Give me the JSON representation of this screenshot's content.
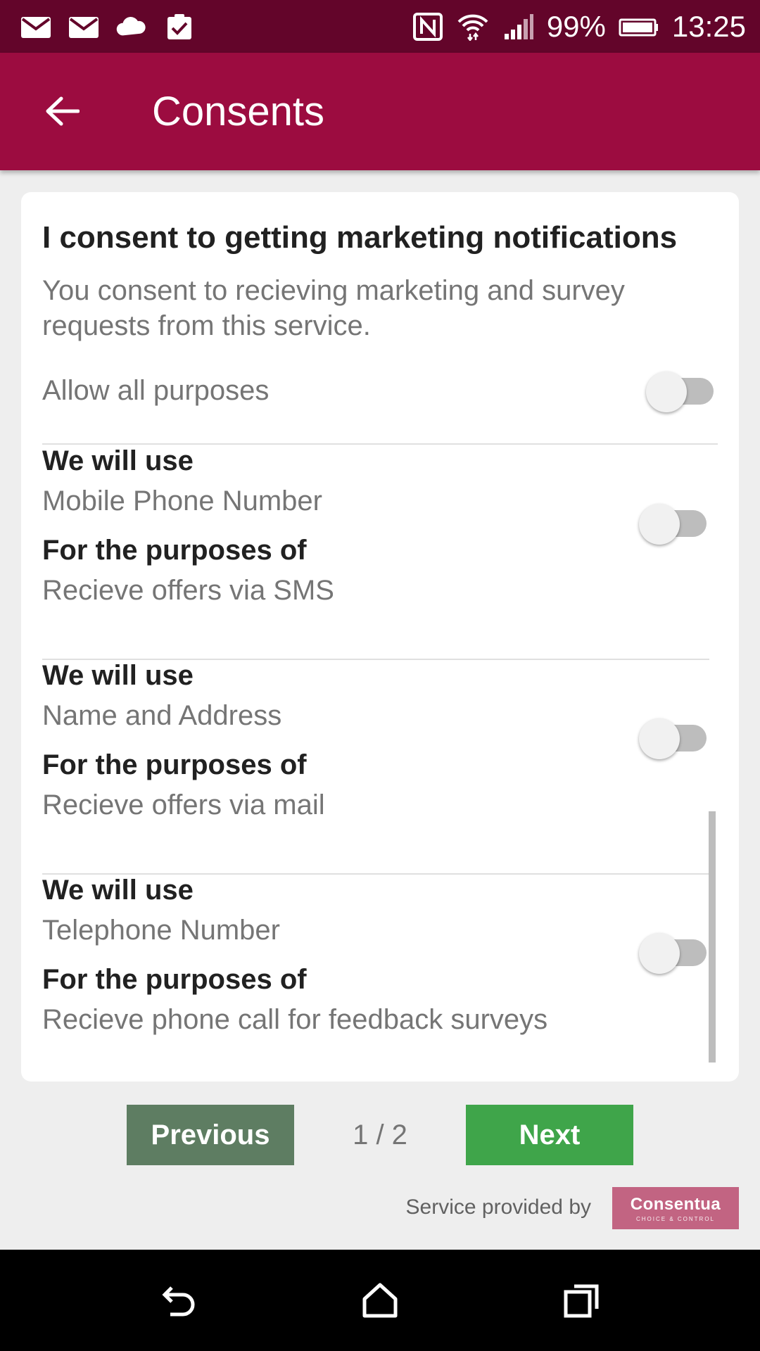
{
  "status_bar": {
    "icons_left": [
      "mail-icon",
      "mail-icon",
      "cloud-icon",
      "clipboard-check-icon"
    ],
    "icons_right": [
      "nfc-icon",
      "wifi-icon",
      "cell-signal-icon",
      "battery-icon"
    ],
    "battery": "99%",
    "time": "13:25"
  },
  "app_bar": {
    "title": "Consents",
    "back_icon": "arrow-left-icon",
    "color": "#9c0c40"
  },
  "card": {
    "title": "I consent to getting marketing notifications",
    "description": "You consent to recieving marketing and survey requests from this service.",
    "allow_all_label": "Allow all purposes",
    "allow_all_on": false,
    "purposes": [
      {
        "use_label": "We will use",
        "use_value": "Mobile Phone Number",
        "purpose_label": "For the purposes of",
        "purpose_value": "Recieve offers via SMS",
        "enabled": false
      },
      {
        "use_label": "We will use",
        "use_value": "Name and Address",
        "purpose_label": "For the purposes of",
        "purpose_value": "Recieve offers via mail",
        "enabled": false
      },
      {
        "use_label": "We will use",
        "use_value": "Telephone Number",
        "purpose_label": "For the purposes of",
        "purpose_value": "Recieve phone call for feedback surveys",
        "enabled": false
      }
    ]
  },
  "pager": {
    "previous_label": "Previous",
    "next_label": "Next",
    "page_indicator": "1 / 2"
  },
  "footer": {
    "provided_by": "Service provided by",
    "logo_text": "Consentua",
    "logo_tagline": "CHOICE & CONTROL"
  },
  "nav_bar": {
    "icons": [
      "back-icon",
      "home-icon",
      "recents-icon"
    ]
  }
}
